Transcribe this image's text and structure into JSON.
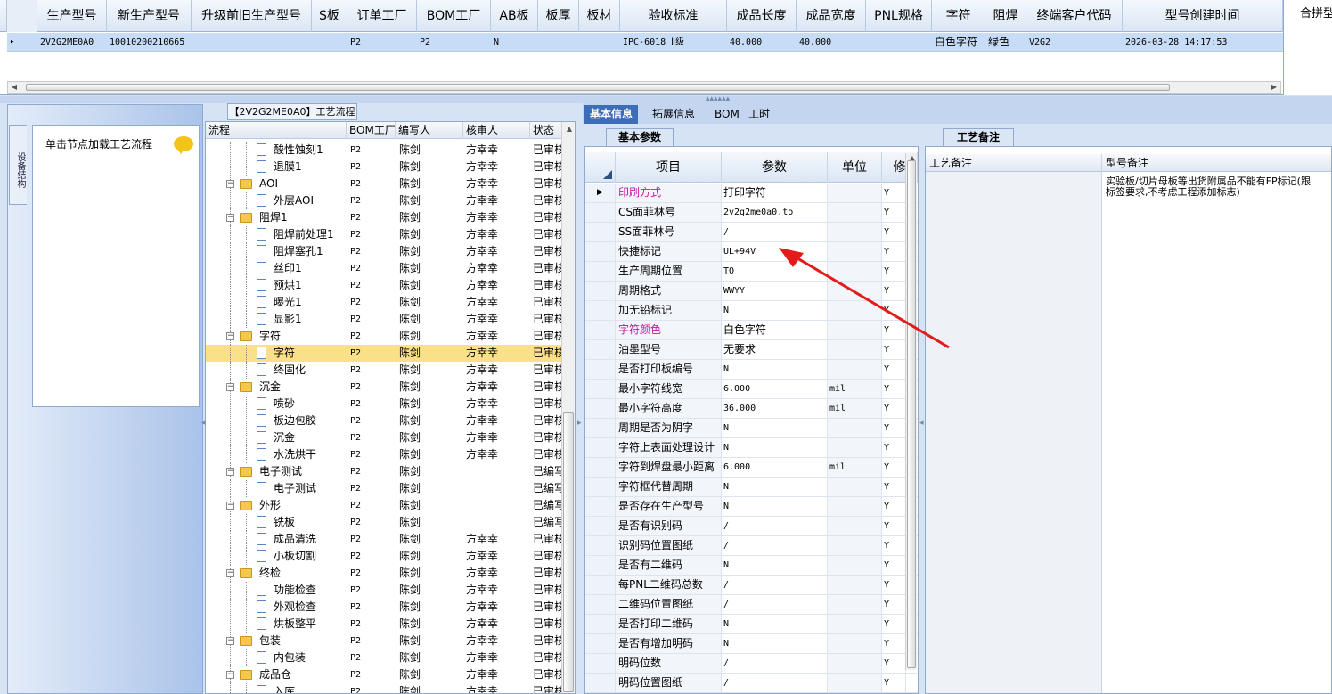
{
  "top_grid": {
    "headers": [
      "生产型号",
      "新生产型号",
      "升级前旧生产型号",
      "S板",
      "订单工厂",
      "BOM工厂",
      "AB板",
      "板厚",
      "板材",
      "验收标准",
      "成品长度",
      "成品宽度",
      "PNL规格",
      "字符",
      "阻焊",
      "终端客户代码",
      "型号创建时间"
    ],
    "row": {
      "model": "2V2G2ME0A0",
      "new_model": "10010200210665",
      "old_model": "",
      "s_board": "",
      "order_factory": "P2",
      "bom_factory": "P2",
      "ab_board": "N",
      "thickness": "",
      "material": "",
      "standard": "IPC-6018 Ⅱ级",
      "length": "40.000",
      "width": "40.000",
      "pnl": "",
      "char": "白色字符",
      "solder": "绿色",
      "client_code": "V2G2",
      "created": "2026-03-28 14:17:53"
    },
    "right_label": "合拼型"
  },
  "left_panel": {
    "vertical_tab": "设备结构",
    "hint": "单击节点加载工艺流程"
  },
  "flow": {
    "tab_title": "【2V2G2ME0A0】工艺流程",
    "headers": [
      "流程",
      "BOM工厂",
      "编写人",
      "核审人",
      "状态"
    ],
    "rows": [
      {
        "level": 2,
        "name": "酸性蚀刻1",
        "bom": "P2",
        "writer": "陈剑",
        "reviewer": "方幸幸",
        "status": "已审核"
      },
      {
        "level": 2,
        "name": "退膜1",
        "bom": "P2",
        "writer": "陈剑",
        "reviewer": "方幸幸",
        "status": "已审核"
      },
      {
        "level": 1,
        "name": "AOI",
        "bom": "P2",
        "writer": "陈剑",
        "reviewer": "方幸幸",
        "status": "已审核"
      },
      {
        "level": 2,
        "name": "外层AOI",
        "bom": "P2",
        "writer": "陈剑",
        "reviewer": "方幸幸",
        "status": "已审核"
      },
      {
        "level": 1,
        "name": "阻焊1",
        "bom": "P2",
        "writer": "陈剑",
        "reviewer": "方幸幸",
        "status": "已审核"
      },
      {
        "level": 2,
        "name": "阻焊前处理1",
        "bom": "P2",
        "writer": "陈剑",
        "reviewer": "方幸幸",
        "status": "已审核"
      },
      {
        "level": 2,
        "name": "阻焊塞孔1",
        "bom": "P2",
        "writer": "陈剑",
        "reviewer": "方幸幸",
        "status": "已审核"
      },
      {
        "level": 2,
        "name": "丝印1",
        "bom": "P2",
        "writer": "陈剑",
        "reviewer": "方幸幸",
        "status": "已审核"
      },
      {
        "level": 2,
        "name": "预烘1",
        "bom": "P2",
        "writer": "陈剑",
        "reviewer": "方幸幸",
        "status": "已审核"
      },
      {
        "level": 2,
        "name": "曝光1",
        "bom": "P2",
        "writer": "陈剑",
        "reviewer": "方幸幸",
        "status": "已审核"
      },
      {
        "level": 2,
        "name": "显影1",
        "bom": "P2",
        "writer": "陈剑",
        "reviewer": "方幸幸",
        "status": "已审核"
      },
      {
        "level": 1,
        "name": "字符",
        "bom": "P2",
        "writer": "陈剑",
        "reviewer": "方幸幸",
        "status": "已审核"
      },
      {
        "level": 2,
        "name": "字符",
        "bom": "P2",
        "writer": "陈剑",
        "reviewer": "方幸幸",
        "status": "已审核",
        "selected": true
      },
      {
        "level": 2,
        "name": "终固化",
        "bom": "P2",
        "writer": "陈剑",
        "reviewer": "方幸幸",
        "status": "已审核"
      },
      {
        "level": 1,
        "name": "沉金",
        "bom": "P2",
        "writer": "陈剑",
        "reviewer": "方幸幸",
        "status": "已审核"
      },
      {
        "level": 2,
        "name": "喷砂",
        "bom": "P2",
        "writer": "陈剑",
        "reviewer": "方幸幸",
        "status": "已审核"
      },
      {
        "level": 2,
        "name": "板边包胶",
        "bom": "P2",
        "writer": "陈剑",
        "reviewer": "方幸幸",
        "status": "已审核"
      },
      {
        "level": 2,
        "name": "沉金",
        "bom": "P2",
        "writer": "陈剑",
        "reviewer": "方幸幸",
        "status": "已审核"
      },
      {
        "level": 2,
        "name": "水洗烘干",
        "bom": "P2",
        "writer": "陈剑",
        "reviewer": "方幸幸",
        "status": "已审核"
      },
      {
        "level": 1,
        "name": "电子测试",
        "bom": "P2",
        "writer": "陈剑",
        "reviewer": "",
        "status": "已编写"
      },
      {
        "level": 2,
        "name": "电子测试",
        "bom": "P2",
        "writer": "陈剑",
        "reviewer": "",
        "status": "已编写"
      },
      {
        "level": 1,
        "name": "外形",
        "bom": "P2",
        "writer": "陈剑",
        "reviewer": "",
        "status": "已编写"
      },
      {
        "level": 2,
        "name": "铣板",
        "bom": "P2",
        "writer": "陈剑",
        "reviewer": "",
        "status": "已编写"
      },
      {
        "level": 2,
        "name": "成品清洗",
        "bom": "P2",
        "writer": "陈剑",
        "reviewer": "方幸幸",
        "status": "已审核"
      },
      {
        "level": 2,
        "name": "小板切割",
        "bom": "P2",
        "writer": "陈剑",
        "reviewer": "方幸幸",
        "status": "已审核"
      },
      {
        "level": 1,
        "name": "终检",
        "bom": "P2",
        "writer": "陈剑",
        "reviewer": "方幸幸",
        "status": "已审核"
      },
      {
        "level": 2,
        "name": "功能检查",
        "bom": "P2",
        "writer": "陈剑",
        "reviewer": "方幸幸",
        "status": "已审核"
      },
      {
        "level": 2,
        "name": "外观检查",
        "bom": "P2",
        "writer": "陈剑",
        "reviewer": "方幸幸",
        "status": "已审核"
      },
      {
        "level": 2,
        "name": "烘板整平",
        "bom": "P2",
        "writer": "陈剑",
        "reviewer": "方幸幸",
        "status": "已审核"
      },
      {
        "level": 1,
        "name": "包装",
        "bom": "P2",
        "writer": "陈剑",
        "reviewer": "方幸幸",
        "status": "已审核"
      },
      {
        "level": 2,
        "name": "内包装",
        "bom": "P2",
        "writer": "陈剑",
        "reviewer": "方幸幸",
        "status": "已审核"
      },
      {
        "level": 1,
        "name": "成品仓",
        "bom": "P2",
        "writer": "陈剑",
        "reviewer": "方幸幸",
        "status": "已审核"
      },
      {
        "level": 2,
        "name": "入库",
        "bom": "P2",
        "writer": "陈剑",
        "reviewer": "方幸幸",
        "status": "已审核"
      }
    ]
  },
  "info_tabs": [
    "基本信息",
    "拓展信息",
    "BOM",
    "工时"
  ],
  "params": {
    "subtab": "基本参数",
    "headers": [
      "项目",
      "参数",
      "单位",
      "修"
    ],
    "rows": [
      {
        "name": "印刷方式",
        "value": "打印字符",
        "unit": "",
        "flag": "Y",
        "pink": true,
        "current": true
      },
      {
        "name": "CS面菲林号",
        "value": "2v2g2me0a0.to",
        "unit": "",
        "flag": "Y"
      },
      {
        "name": "SS面菲林号",
        "value": "/",
        "unit": "",
        "flag": "Y"
      },
      {
        "name": "快捷标记",
        "value": "UL+94V",
        "unit": "",
        "flag": "Y"
      },
      {
        "name": "生产周期位置",
        "value": "TO",
        "unit": "",
        "flag": "Y"
      },
      {
        "name": "周期格式",
        "value": "WWYY",
        "unit": "",
        "flag": "Y"
      },
      {
        "name": "加无铅标记",
        "value": "N",
        "unit": "",
        "flag": "Y"
      },
      {
        "name": "字符颜色",
        "value": "白色字符",
        "unit": "",
        "flag": "Y",
        "pink": true
      },
      {
        "name": "油墨型号",
        "value": "无要求",
        "unit": "",
        "flag": "Y"
      },
      {
        "name": "是否打印板编号",
        "value": "N",
        "unit": "",
        "flag": "Y"
      },
      {
        "name": "最小字符线宽",
        "value": "6.000",
        "unit": "mil",
        "flag": "Y"
      },
      {
        "name": "最小字符高度",
        "value": "36.000",
        "unit": "mil",
        "flag": "Y"
      },
      {
        "name": "周期是否为阴字",
        "value": "N",
        "unit": "",
        "flag": "Y"
      },
      {
        "name": "字符上表面处理设计",
        "value": "N",
        "unit": "",
        "flag": "Y"
      },
      {
        "name": "字符到焊盘最小距离",
        "value": "6.000",
        "unit": "mil",
        "flag": "Y"
      },
      {
        "name": "字符框代替周期",
        "value": "N",
        "unit": "",
        "flag": "Y"
      },
      {
        "name": "是否存在生产型号",
        "value": "N",
        "unit": "",
        "flag": "Y"
      },
      {
        "name": "是否有识别码",
        "value": "/",
        "unit": "",
        "flag": "Y"
      },
      {
        "name": "识别码位置图纸",
        "value": "/",
        "unit": "",
        "flag": "Y"
      },
      {
        "name": "是否有二维码",
        "value": "N",
        "unit": "",
        "flag": "Y"
      },
      {
        "name": "每PNL二维码总数",
        "value": "/",
        "unit": "",
        "flag": "Y"
      },
      {
        "name": "二维码位置图纸",
        "value": "/",
        "unit": "",
        "flag": "Y"
      },
      {
        "name": "是否打印二维码",
        "value": "N",
        "unit": "",
        "flag": "Y"
      },
      {
        "name": "是否有增加明码",
        "value": "N",
        "unit": "",
        "flag": "Y"
      },
      {
        "name": "明码位数",
        "value": "/",
        "unit": "",
        "flag": "Y"
      },
      {
        "name": "明码位置图纸",
        "value": "/",
        "unit": "",
        "flag": "Y"
      }
    ]
  },
  "remarks": {
    "subtab": "工艺备注",
    "headers": [
      "工艺备注",
      "型号备注"
    ],
    "model_remark_line1": "实验板/切片母板等出货附属品不能有FP标记(跟",
    "model_remark_line2": "标签要求,不考虑工程添加标志)"
  },
  "colors": {
    "accent": "#3c6db5",
    "selected_row": "#fbe08a",
    "arrow": "#e31b1b",
    "pink_label": "#c2189a"
  }
}
